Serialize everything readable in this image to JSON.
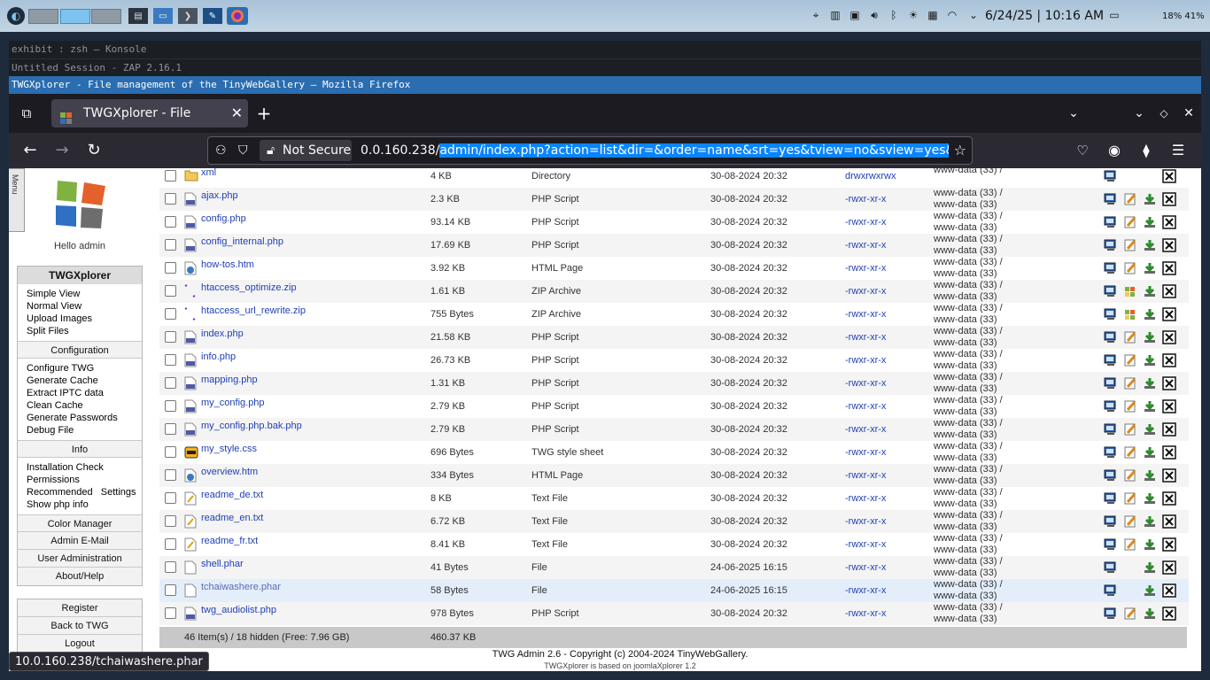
{
  "taskbar": {
    "date": "6/24/25",
    "time": "10:16 AM",
    "battery1": "18%",
    "battery2": "41%"
  },
  "windows": {
    "konsole_title": "exhibit : zsh — Konsole",
    "zap_title": "Untitled Session - ZAP 2.16.1",
    "firefox_title": "TWGXplorer - File management of the TinyWebGallery — Mozilla Firefox"
  },
  "browser": {
    "tab_title": "TWGXplorer - File manager",
    "not_secure": "Not Secure",
    "url_host": "0.0.160.238/",
    "url_path": "admin/index.php?action=list&dir=&order=name&srt=yes&tview=no&sview=yes&lang=en"
  },
  "sidebar": {
    "menu_handle": "Menu",
    "hello": "Hello admin",
    "title": "TWGXplorer",
    "views": [
      "Simple View",
      "Normal View",
      "Upload Images",
      "Split Files"
    ],
    "config_head": "Configuration",
    "config_items": [
      "Configure TWG",
      "Generate Cache",
      "Extract IPTC data",
      "Clean Cache",
      "Generate Passwords",
      "Debug File"
    ],
    "info_head": "Info",
    "info_items": [
      "Installation Check",
      "Permissions",
      "Recommended   Settings",
      "Show php info"
    ],
    "color_manager": "Color Manager",
    "admin_email": "Admin E-Mail",
    "user_admin": "User Administration",
    "about": "About/Help",
    "register": "Register",
    "back": "Back to TWG",
    "logout": "Logout"
  },
  "files": [
    {
      "name": "xml",
      "size": "4 KB",
      "type": "Directory",
      "date": "30-08-2024 20:32",
      "perm": "drwxrwxrwx",
      "owner1": "www-data (33) /",
      "owner2": "",
      "icon": "folder-icon"
    },
    {
      "name": "ajax.php",
      "size": "2.3 KB",
      "type": "PHP Script",
      "date": "30-08-2024 20:32",
      "perm": "-rwxr-xr-x",
      "owner1": "www-data (33) /",
      "owner2": "www-data (33)",
      "icon": "php-file-icon"
    },
    {
      "name": "config.php",
      "size": "93.14 KB",
      "type": "PHP Script",
      "date": "30-08-2024 20:32",
      "perm": "-rwxr-xr-x",
      "owner1": "www-data (33) /",
      "owner2": "www-data (33)",
      "icon": "php-file-icon"
    },
    {
      "name": "config_internal.php",
      "size": "17.69 KB",
      "type": "PHP Script",
      "date": "30-08-2024 20:32",
      "perm": "-rwxr-xr-x",
      "owner1": "www-data (33) /",
      "owner2": "www-data (33)",
      "icon": "php-file-icon"
    },
    {
      "name": "how-tos.htm",
      "size": "3.92 KB",
      "type": "HTML Page",
      "date": "30-08-2024 20:32",
      "perm": "-rwxr-xr-x",
      "owner1": "www-data (33) /",
      "owner2": "www-data (33)",
      "icon": "html-file-icon"
    },
    {
      "name": "htaccess_optimize.zip",
      "size": "1.61 KB",
      "type": "ZIP Archive",
      "date": "30-08-2024 20:32",
      "perm": "-rwxr-xr-x",
      "owner1": "www-data (33) /",
      "owner2": "www-data (33)",
      "icon": "zip-file-icon"
    },
    {
      "name": "htaccess_url_rewrite.zip",
      "size": "755 Bytes",
      "type": "ZIP Archive",
      "date": "30-08-2024 20:32",
      "perm": "-rwxr-xr-x",
      "owner1": "www-data (33) /",
      "owner2": "www-data (33)",
      "icon": "zip-file-icon"
    },
    {
      "name": "index.php",
      "size": "21.58 KB",
      "type": "PHP Script",
      "date": "30-08-2024 20:32",
      "perm": "-rwxr-xr-x",
      "owner1": "www-data (33) /",
      "owner2": "www-data (33)",
      "icon": "php-file-icon"
    },
    {
      "name": "info.php",
      "size": "26.73 KB",
      "type": "PHP Script",
      "date": "30-08-2024 20:32",
      "perm": "-rwxr-xr-x",
      "owner1": "www-data (33) /",
      "owner2": "www-data (33)",
      "icon": "php-file-icon"
    },
    {
      "name": "mapping.php",
      "size": "1.31 KB",
      "type": "PHP Script",
      "date": "30-08-2024 20:32",
      "perm": "-rwxr-xr-x",
      "owner1": "www-data (33) /",
      "owner2": "www-data (33)",
      "icon": "php-file-icon"
    },
    {
      "name": "my_config.php",
      "size": "2.79 KB",
      "type": "PHP Script",
      "date": "30-08-2024 20:32",
      "perm": "-rwxr-xr-x",
      "owner1": "www-data (33) /",
      "owner2": "www-data (33)",
      "icon": "php-file-icon"
    },
    {
      "name": "my_config.php.bak.php",
      "size": "2.79 KB",
      "type": "PHP Script",
      "date": "30-08-2024 20:32",
      "perm": "-rwxr-xr-x",
      "owner1": "www-data (33) /",
      "owner2": "www-data (33)",
      "icon": "php-file-icon"
    },
    {
      "name": "my_style.css",
      "size": "696 Bytes",
      "type": "TWG style sheet",
      "date": "30-08-2024 20:32",
      "perm": "-rwxr-xr-x",
      "owner1": "www-data (33) /",
      "owner2": "www-data (33)",
      "icon": "css-file-icon"
    },
    {
      "name": "overview.htm",
      "size": "334 Bytes",
      "type": "HTML Page",
      "date": "30-08-2024 20:32",
      "perm": "-rwxr-xr-x",
      "owner1": "www-data (33) /",
      "owner2": "www-data (33)",
      "icon": "html-file-icon"
    },
    {
      "name": "readme_de.txt",
      "size": "8 KB",
      "type": "Text File",
      "date": "30-08-2024 20:32",
      "perm": "-rwxr-xr-x",
      "owner1": "www-data (33) /",
      "owner2": "www-data (33)",
      "icon": "text-file-icon"
    },
    {
      "name": "readme_en.txt",
      "size": "6.72 KB",
      "type": "Text File",
      "date": "30-08-2024 20:32",
      "perm": "-rwxr-xr-x",
      "owner1": "www-data (33) /",
      "owner2": "www-data (33)",
      "icon": "text-file-icon"
    },
    {
      "name": "readme_fr.txt",
      "size": "8.41 KB",
      "type": "Text File",
      "date": "30-08-2024 20:32",
      "perm": "-rwxr-xr-x",
      "owner1": "www-data (33) /",
      "owner2": "www-data (33)",
      "icon": "text-file-icon"
    },
    {
      "name": "shell.phar",
      "size": "41 Bytes",
      "type": "File",
      "date": "24-06-2025 16:15",
      "perm": "-rwxr-xr-x",
      "owner1": "www-data (33) /",
      "owner2": "www-data (33)",
      "icon": "generic-file-icon"
    },
    {
      "name": "tchaiwashere.phar",
      "size": "58 Bytes",
      "type": "File",
      "date": "24-06-2025 16:15",
      "perm": "-rwxr-xr-x",
      "owner1": "www-data (33) /",
      "owner2": "www-data (33)",
      "icon": "generic-file-icon"
    },
    {
      "name": "twg_audiolist.php",
      "size": "978 Bytes",
      "type": "PHP Script",
      "date": "30-08-2024 20:32",
      "perm": "-rwxr-xr-x",
      "owner1": "www-data (33) /",
      "owner2": "www-data (33)",
      "icon": "php-file-icon"
    }
  ],
  "summary": {
    "items": "46 Item(s) / 18 hidden (Free: 7.96 GB)",
    "total": "460.37 KB"
  },
  "footer": {
    "copyright_prefix": "TWG Admin 2.6 - ",
    "copyright_link": "Copyright (c) 2004-2024 TinyWebGallery.",
    "based": "TWGXplorer is based on joomlaXplorer 1.2"
  },
  "status_url": "10.0.160.238/tchaiwashere.phar",
  "colors": {
    "link": "#1f3fb5",
    "selection": "#0a84ff",
    "title_bar": "#2a6db0"
  }
}
